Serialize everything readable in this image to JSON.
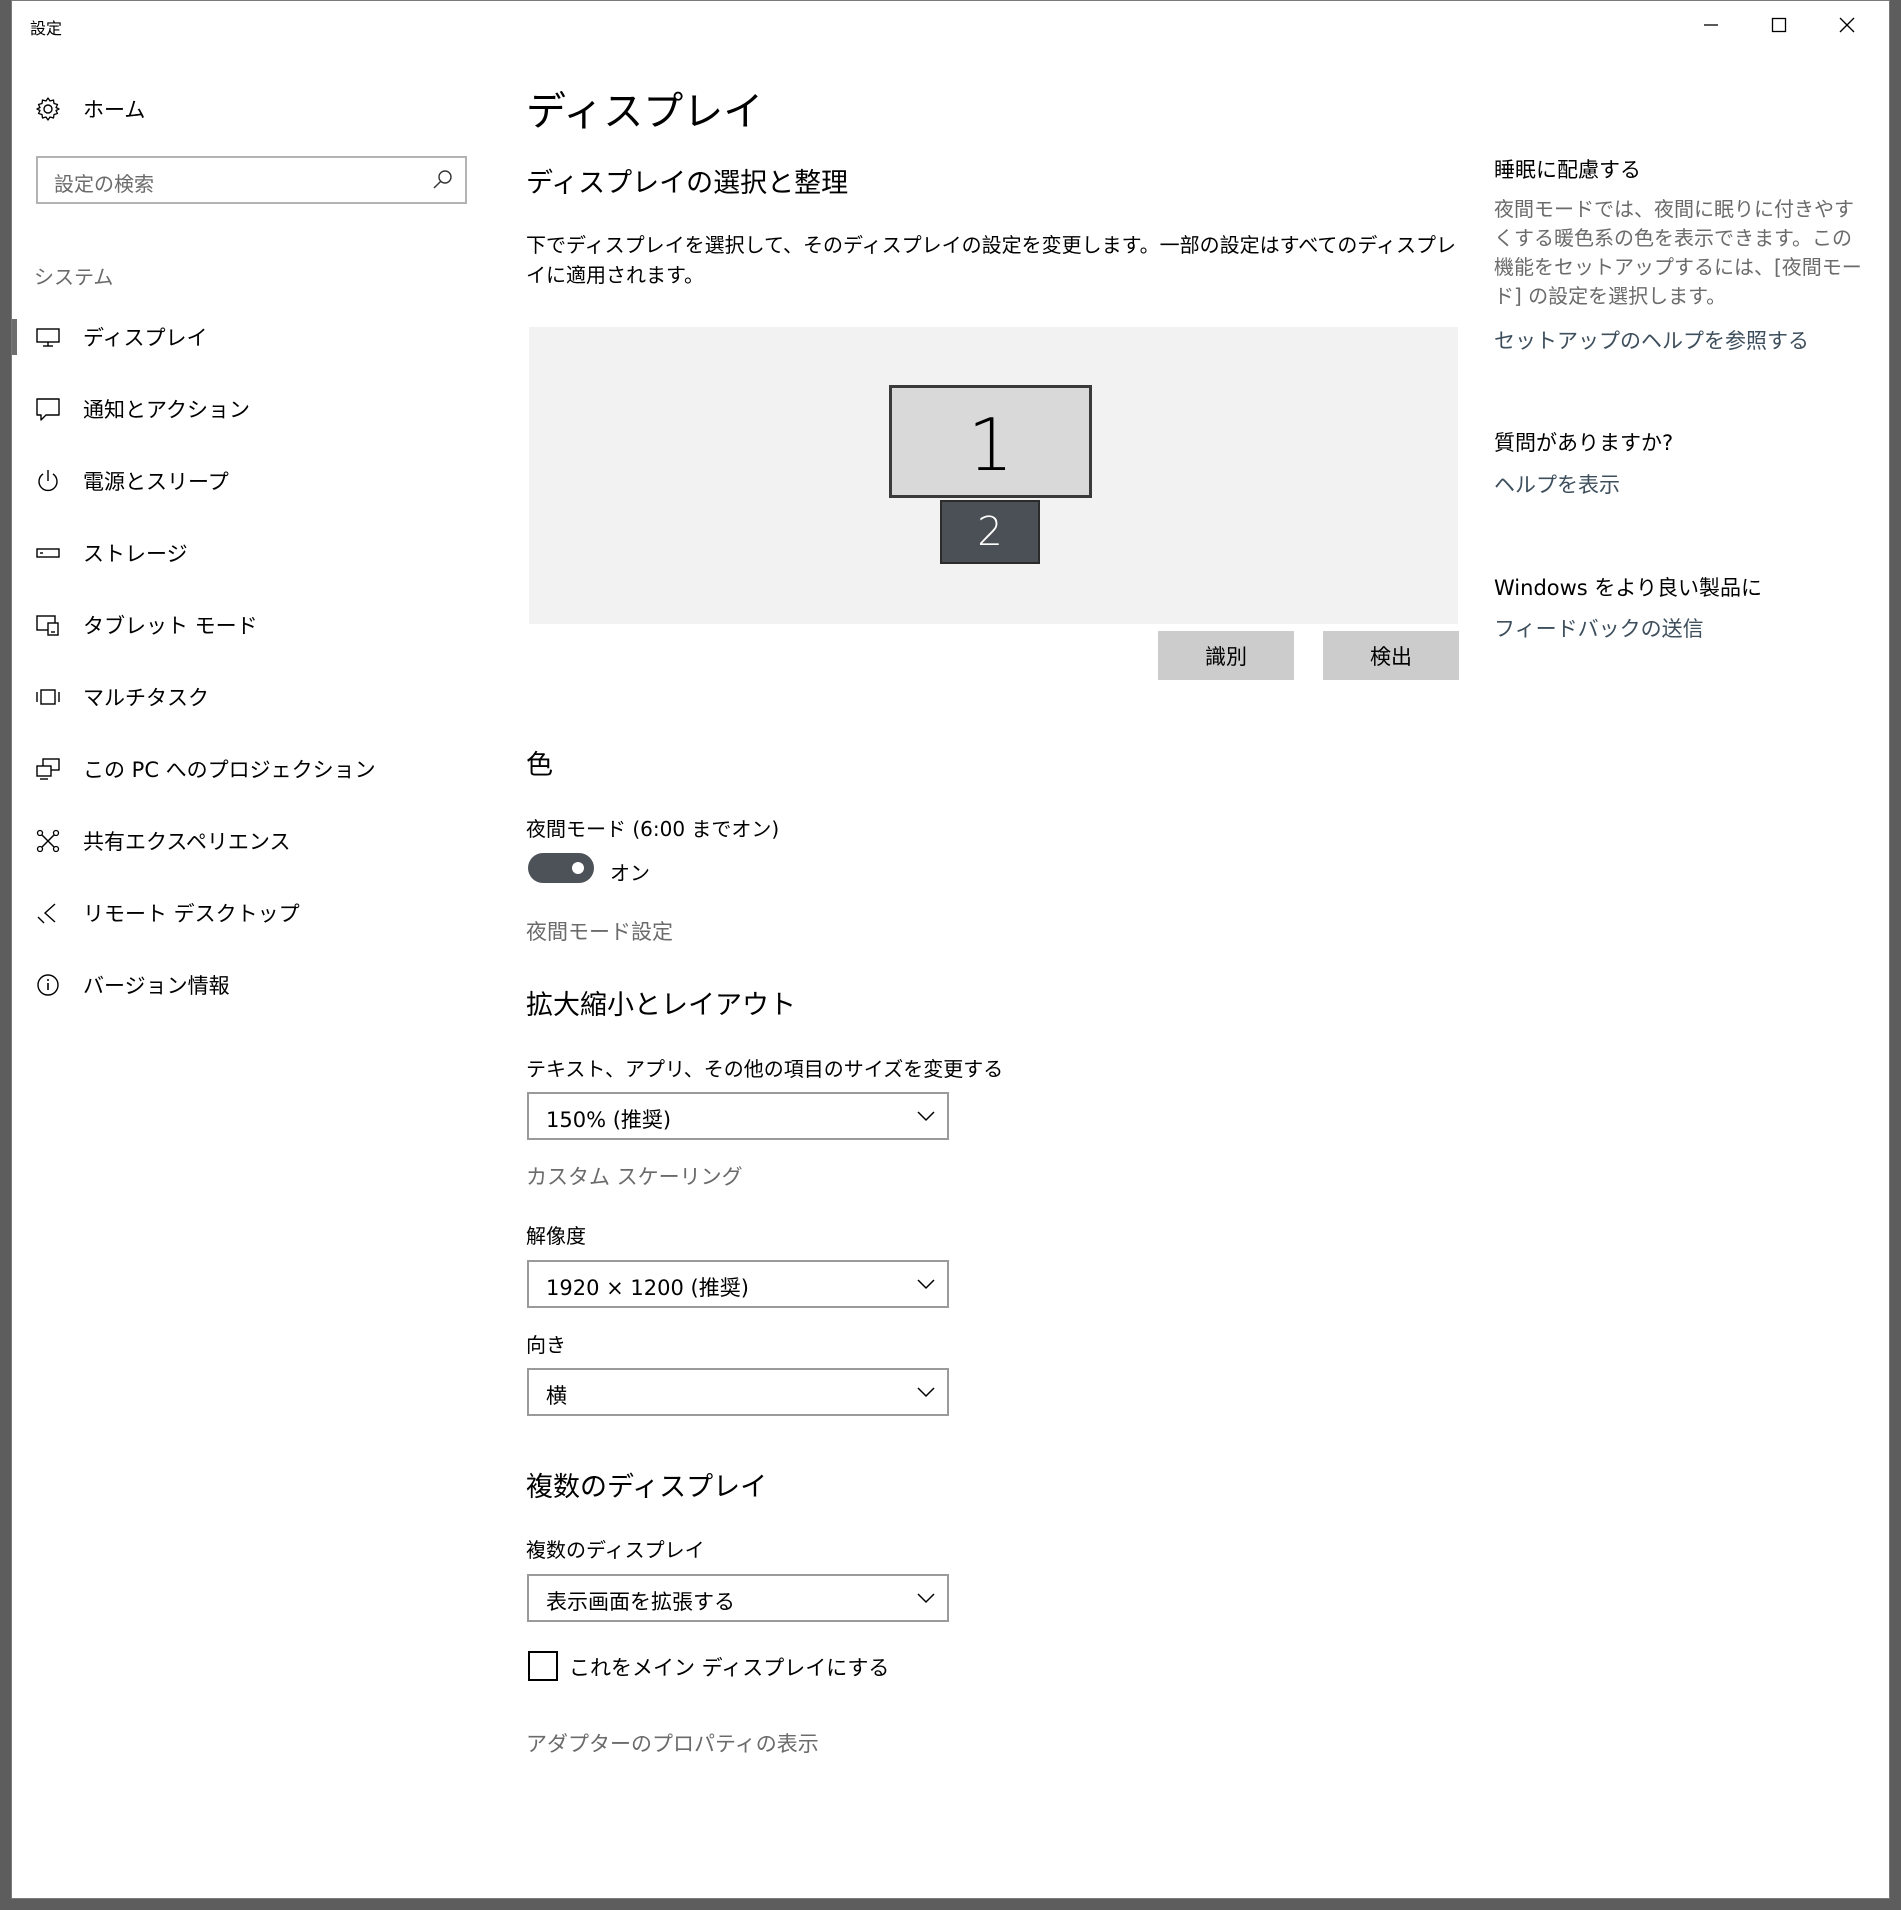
{
  "window": {
    "title": "設定"
  },
  "sidebar": {
    "home_label": "ホーム",
    "search_placeholder": "設定の検索",
    "section_label": "システム",
    "items": [
      {
        "label": "ディスプレイ",
        "icon": "monitor-icon"
      },
      {
        "label": "通知とアクション",
        "icon": "notification-icon"
      },
      {
        "label": "電源とスリープ",
        "icon": "power-icon"
      },
      {
        "label": "ストレージ",
        "icon": "storage-icon"
      },
      {
        "label": "タブレット モード",
        "icon": "tablet-mode-icon"
      },
      {
        "label": "マルチタスク",
        "icon": "multitask-icon"
      },
      {
        "label": "この PC へのプロジェクション",
        "icon": "projection-icon"
      },
      {
        "label": "共有エクスペリエンス",
        "icon": "shared-experience-icon"
      },
      {
        "label": "リモート デスクトップ",
        "icon": "remote-desktop-icon"
      },
      {
        "label": "バージョン情報",
        "icon": "info-icon"
      }
    ]
  },
  "main": {
    "page_title": "ディスプレイ",
    "select_section": {
      "title": "ディスプレイの選択と整理",
      "description": "下でディスプレイを選択して、そのディスプレイの設定を変更します。一部の設定はすべてのディスプレイに適用されます。",
      "monitor1": "1",
      "monitor2": "2",
      "identify_button": "識別",
      "detect_button": "検出"
    },
    "color_section": {
      "title": "色",
      "night_mode_label": "夜間モード (6:00 までオン)",
      "toggle_state": "オン",
      "night_mode_settings_link": "夜間モード設定"
    },
    "scale_section": {
      "title": "拡大縮小とレイアウト",
      "size_label": "テキスト、アプリ、その他の項目のサイズを変更する",
      "size_value": "150% (推奨)",
      "custom_scaling_link": "カスタム スケーリング",
      "resolution_label": "解像度",
      "resolution_value": "1920 × 1200 (推奨)",
      "orientation_label": "向き",
      "orientation_value": "横"
    },
    "multi_section": {
      "title": "複数のディスプレイ",
      "multi_label": "複数のディスプレイ",
      "multi_value": "表示画面を拡張する",
      "main_display_checkbox": "これをメイン ディスプレイにする",
      "adapter_link": "アダプターのプロパティの表示"
    }
  },
  "right": {
    "sleep_title": "睡眠に配慮する",
    "sleep_desc": "夜間モードでは、夜間に眠りに付きやすくする暖色系の色を表示できます。この機能をセットアップするには、[夜間モード] の設定を選択します。",
    "setup_help_link": "セットアップのヘルプを参照する",
    "question_title": "質問がありますか?",
    "help_link": "ヘルプを表示",
    "feedback_title": "Windows をより良い製品に",
    "feedback_link": "フィードバックの送信"
  },
  "colors": {
    "accent_dark": "#4c5257",
    "link_gray": "#6b6b6b",
    "panel_bg": "#f2f2f2",
    "button_bg": "#cccccc"
  }
}
